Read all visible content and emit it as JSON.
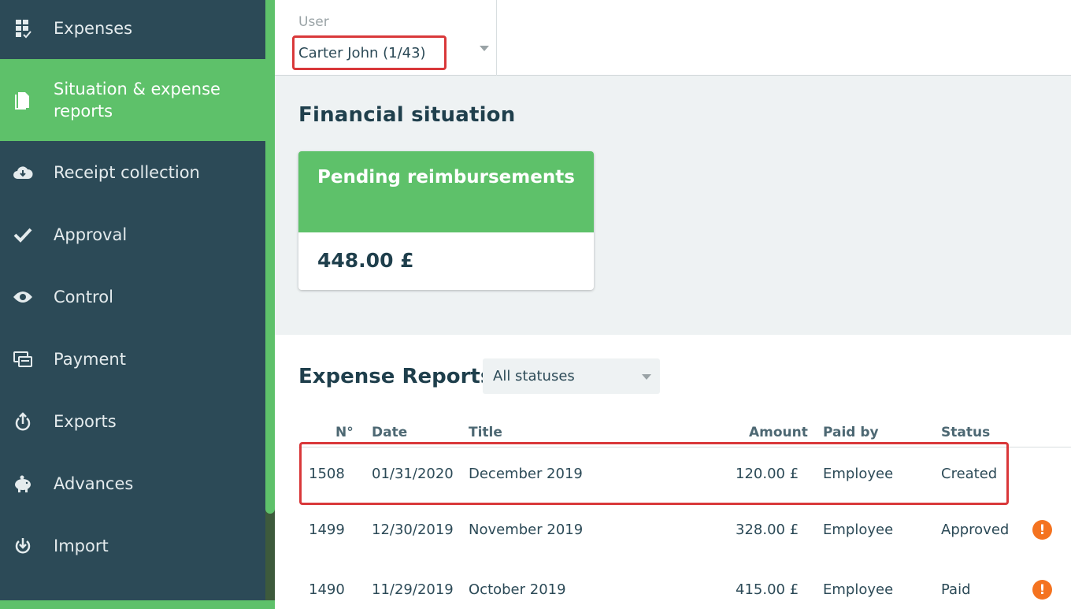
{
  "sidebar": {
    "items": [
      {
        "label": "Expenses",
        "icon": "expenses-grid-icon"
      },
      {
        "label": "Situation & expense reports",
        "icon": "document-icon",
        "active": true
      },
      {
        "label": "Receipt collection",
        "icon": "cloud-download-icon"
      },
      {
        "label": "Approval",
        "icon": "checkmark-icon"
      },
      {
        "label": "Control",
        "icon": "eye-icon"
      },
      {
        "label": "Payment",
        "icon": "payment-icon"
      },
      {
        "label": "Exports",
        "icon": "upload-icon"
      },
      {
        "label": "Advances",
        "icon": "piggy-bank-icon"
      },
      {
        "label": "Import",
        "icon": "download-icon"
      }
    ]
  },
  "user": {
    "label": "User",
    "value": "Carter John (1/43)"
  },
  "financial": {
    "title": "Financial situation",
    "pending_title": "Pending reimbursements",
    "pending_amount": "448.00 £"
  },
  "reports": {
    "title": "Expense Reports",
    "filter_value": "All statuses",
    "columns": {
      "number": "N°",
      "date": "Date",
      "title": "Title",
      "amount": "Amount",
      "paid_by": "Paid by",
      "status": "Status"
    },
    "rows": [
      {
        "number": "1508",
        "date": "01/31/2020",
        "title": "December 2019",
        "amount": "120.00 £",
        "paid_by": "Employee",
        "status": "Created",
        "warning": false
      },
      {
        "number": "1499",
        "date": "12/30/2019",
        "title": "November 2019",
        "amount": "328.00 £",
        "paid_by": "Employee",
        "status": "Approved",
        "warning": true
      },
      {
        "number": "1490",
        "date": "11/29/2019",
        "title": "October 2019",
        "amount": "415.00 £",
        "paid_by": "Employee",
        "status": "Paid",
        "warning": true
      }
    ],
    "warning_glyph": "!"
  },
  "colors": {
    "sidebar": "#2c4a57",
    "accent_green": "#5ec16a",
    "highlight_red": "#d9383a",
    "warning_orange": "#f47320"
  }
}
